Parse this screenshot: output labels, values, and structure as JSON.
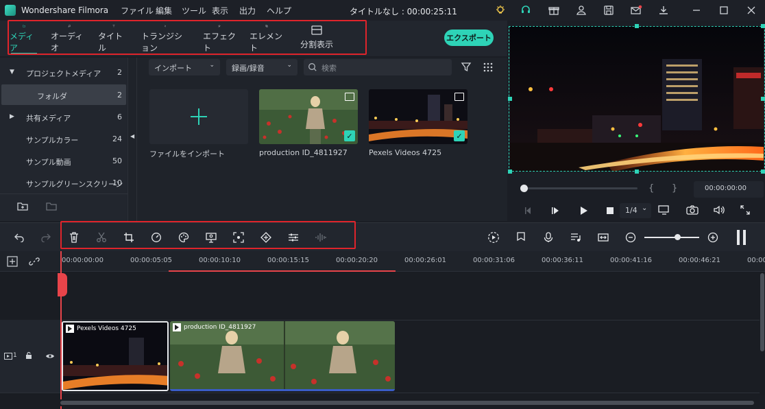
{
  "app": {
    "name": "Wondershare Filmora",
    "menu": [
      "ファイル",
      "編集",
      "ツール",
      "表示",
      "出力",
      "ヘルプ"
    ],
    "document_title": "タイトルなし : 00:00:25:11"
  },
  "tabs": [
    {
      "label": "メディア",
      "icon": "folder-icon",
      "active": true
    },
    {
      "label": "オーディオ",
      "icon": "music-note-icon",
      "active": false
    },
    {
      "label": "タイトル",
      "icon": "text-icon",
      "active": false
    },
    {
      "label": "トランジション",
      "icon": "transition-icon",
      "active": false
    },
    {
      "label": "エフェクト",
      "icon": "effects-icon",
      "active": false
    },
    {
      "label": "エレメント",
      "icon": "elements-icon",
      "active": false
    },
    {
      "label": "分割表示",
      "icon": "split-screen-icon",
      "active": false
    }
  ],
  "export_label": "エクスポート",
  "folders": [
    {
      "label": "プロジェクトメディア",
      "count": "2",
      "caret": "▼"
    },
    {
      "label": "フォルダ",
      "count": "2",
      "selected": true
    },
    {
      "label": "共有メディア",
      "count": "6",
      "caret": "▶"
    },
    {
      "label": "サンプルカラー",
      "count": "24"
    },
    {
      "label": "サンプル動画",
      "count": "50"
    },
    {
      "label": "サンプルグリーンスクリーン",
      "count": "10"
    }
  ],
  "media": {
    "import_dropdown": "インポート",
    "record_dropdown": "録画/録音",
    "search_placeholder": "検索",
    "import_tile_label": "ファイルをインポート",
    "items": [
      {
        "label": "production ID_4811927"
      },
      {
        "label": "Pexels Videos 4725"
      }
    ]
  },
  "preview": {
    "timecode": "00:00:00:00",
    "bracket_in": "{",
    "bracket_out": "}",
    "quality": "1/4"
  },
  "ruler": [
    "00:00:00:00",
    "00:00:05:05",
    "00:00:10:10",
    "00:00:15:15",
    "00:00:20:20",
    "00:00:26:01",
    "00:00:31:06",
    "00:00:36:11",
    "00:00:41:16",
    "00:00:46:21",
    "00:00"
  ],
  "timeline": {
    "track_number": "1",
    "clips": [
      {
        "title": "Pexels Videos 4725"
      },
      {
        "title": "production ID_4811927"
      }
    ]
  },
  "colors": {
    "accent": "#2ed3b7",
    "highlight_box": "#e0242b",
    "playhead": "#e8444a"
  }
}
